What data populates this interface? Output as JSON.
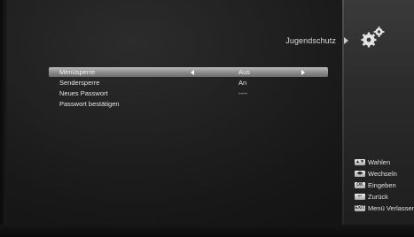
{
  "header": {
    "title": "Jugendschutz"
  },
  "menu": {
    "items": [
      {
        "label": "Menüsperre",
        "value": "Aus",
        "selected": true
      },
      {
        "label": "Sendersperre",
        "value": "An"
      },
      {
        "label": "Neues Passwort",
        "value": "----"
      },
      {
        "label": "Passwort bestätigen",
        "value": ""
      }
    ]
  },
  "legend": {
    "items": [
      {
        "key_icon": "up-down-key-icon",
        "key_glyph": "▲▼",
        "label": "Wahlen"
      },
      {
        "key_icon": "left-right-key-icon",
        "key_glyph": "◀▶",
        "label": "Wechseln"
      },
      {
        "key_icon": "ok-key-icon",
        "key_glyph": "OK",
        "label": "Eingeben"
      },
      {
        "key_icon": "back-key-icon",
        "key_glyph": "↩",
        "label": "Zurück"
      },
      {
        "key_icon": "exit-key-icon",
        "key_glyph": "EXIT",
        "label": "Menü Verlassen"
      }
    ]
  },
  "colors": {
    "background": "#1a1a1a",
    "highlight": "#9a9a9a",
    "text": "#e6e6e6"
  }
}
